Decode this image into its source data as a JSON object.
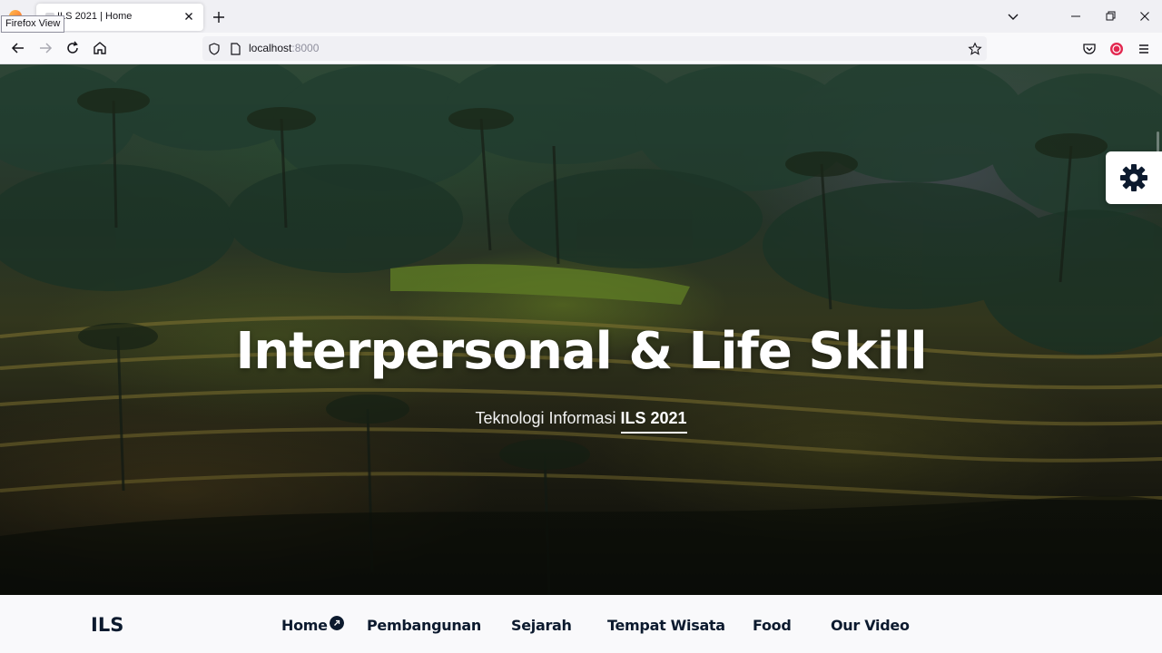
{
  "browser": {
    "tooltip": "Firefox View",
    "tab_title": "ILS 2021 | Home",
    "url_host": "localhost",
    "url_port": ":8000"
  },
  "hero": {
    "title": "Interpersonal & Life Skill",
    "subtitle_prefix": "Teknologi Informasi ",
    "subtitle_strong": "ILS 2021"
  },
  "nav": {
    "brand": "ILS",
    "items": [
      {
        "label": "Home"
      },
      {
        "label": "Pembangunan"
      },
      {
        "label": "Sejarah"
      },
      {
        "label": "Tempat Wisata"
      },
      {
        "label": "Food"
      },
      {
        "label": "Our Video"
      }
    ]
  },
  "icons": {
    "settings": "gear-icon",
    "active_marker": "arrow-up-right-icon"
  },
  "colors": {
    "brand": "#0c1a2e",
    "hero_text": "#ffffff",
    "nav_bg": "#f9f9fb"
  }
}
